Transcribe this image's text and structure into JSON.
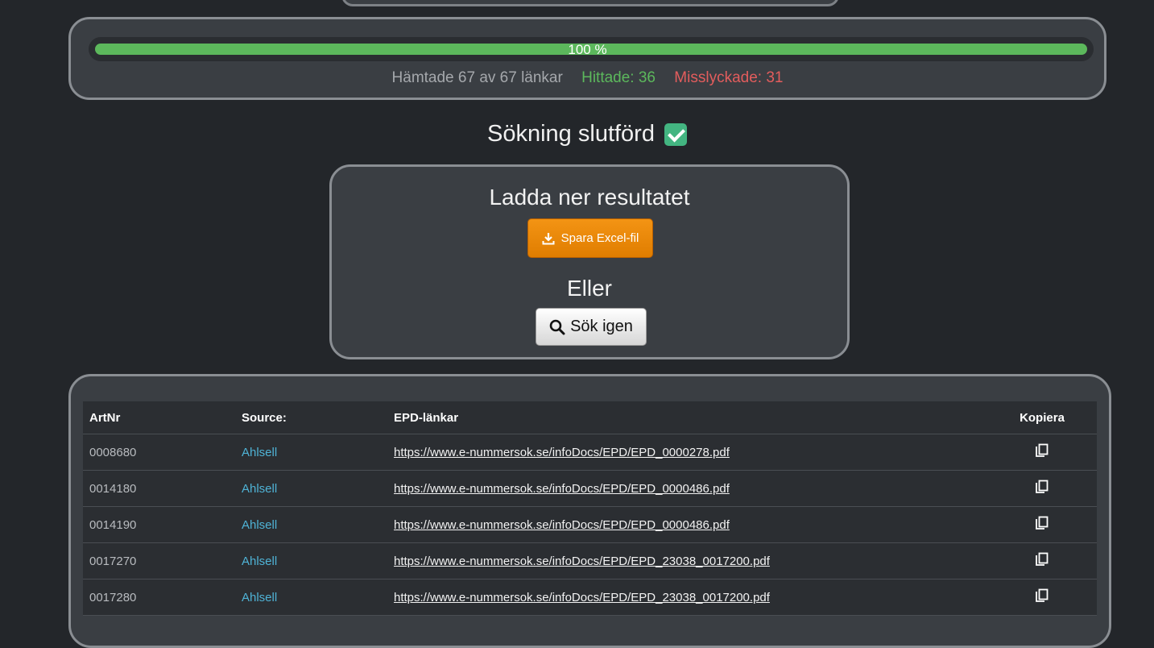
{
  "progress": {
    "percent_value": 100,
    "label": "100 %",
    "fetched_text": "Hämtade 67 av 67 länkar",
    "found_text": "Hittade: 36",
    "failed_text": "Misslyckade: 31",
    "colors": {
      "fill": "#5cb85c",
      "found": "#5cb85c",
      "failed": "#e35d5d"
    }
  },
  "status": {
    "text": "Sökning slutförd",
    "icon": "check-mark-icon"
  },
  "download": {
    "title": "Ladda ner resultatet",
    "excel_button_label": "Spara Excel-fil",
    "excel_icon": "download-icon",
    "or_label": "Eller",
    "search_again_label": "Sök igen",
    "search_icon": "search-icon",
    "colors": {
      "excel_button": "#f39414"
    }
  },
  "table": {
    "headers": {
      "artnr": "ArtNr",
      "source": "Source:",
      "epd": "EPD-länkar",
      "copy": "Kopiera"
    },
    "copy_icon": "copy-icon",
    "rows": [
      {
        "artnr": "0008680",
        "source": "Ahlsell",
        "link": "https://www.e-nummersok.se/infoDocs/EPD/EPD_0000278.pdf"
      },
      {
        "artnr": "0014180",
        "source": "Ahlsell",
        "link": "https://www.e-nummersok.se/infoDocs/EPD/EPD_0000486.pdf"
      },
      {
        "artnr": "0014190",
        "source": "Ahlsell",
        "link": "https://www.e-nummersok.se/infoDocs/EPD/EPD_0000486.pdf"
      },
      {
        "artnr": "0017270",
        "source": "Ahlsell",
        "link": "https://www.e-nummersok.se/infoDocs/EPD/EPD_23038_0017200.pdf"
      },
      {
        "artnr": "0017280",
        "source": "Ahlsell",
        "link": "https://www.e-nummersok.se/infoDocs/EPD/EPD_23038_0017200.pdf"
      }
    ]
  }
}
